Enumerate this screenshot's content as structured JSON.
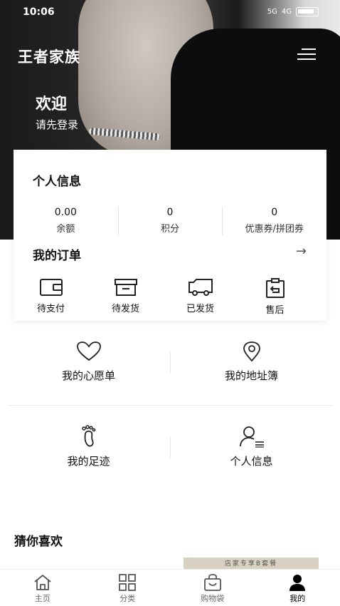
{
  "status_bar": {
    "time": "10:06",
    "battery": "100",
    "signal_5g": "5G",
    "signal_4g": "4G"
  },
  "header": {
    "brand": "王者家族",
    "menu_icon": "hamburger-icon"
  },
  "hero": {
    "welcome": "欢迎",
    "login_prompt": "请先登录"
  },
  "personal_info": {
    "title": "个人信息",
    "stats": [
      {
        "value": "0.00",
        "label": "余额"
      },
      {
        "value": "0",
        "label": "积分"
      },
      {
        "value": "0",
        "label": "优惠券/拼团券"
      }
    ]
  },
  "orders": {
    "title": "我的订单",
    "arrow_icon": "arrow-right-icon",
    "items": [
      {
        "label": "待支付",
        "icon": "wallet-icon"
      },
      {
        "label": "待发货",
        "icon": "box-icon"
      },
      {
        "label": "已发货",
        "icon": "truck-icon"
      },
      {
        "label": "售后",
        "icon": "clipboard-return-icon"
      }
    ]
  },
  "services": [
    {
      "label": "我的心愿单",
      "icon": "heart-icon"
    },
    {
      "label": "我的地址簿",
      "icon": "location-pin-icon"
    },
    {
      "label": "我的足迹",
      "icon": "footprint-icon"
    },
    {
      "label": "个人信息",
      "icon": "user-list-icon"
    }
  ],
  "recommend": {
    "title": "猜你喜欢",
    "product_caption": "店家专享B套餐"
  },
  "tabbar": [
    {
      "label": "主页",
      "icon": "home-icon"
    },
    {
      "label": "分类",
      "icon": "grid-icon"
    },
    {
      "label": "购物袋",
      "icon": "bag-icon"
    },
    {
      "label": "我的",
      "icon": "person-icon"
    }
  ]
}
